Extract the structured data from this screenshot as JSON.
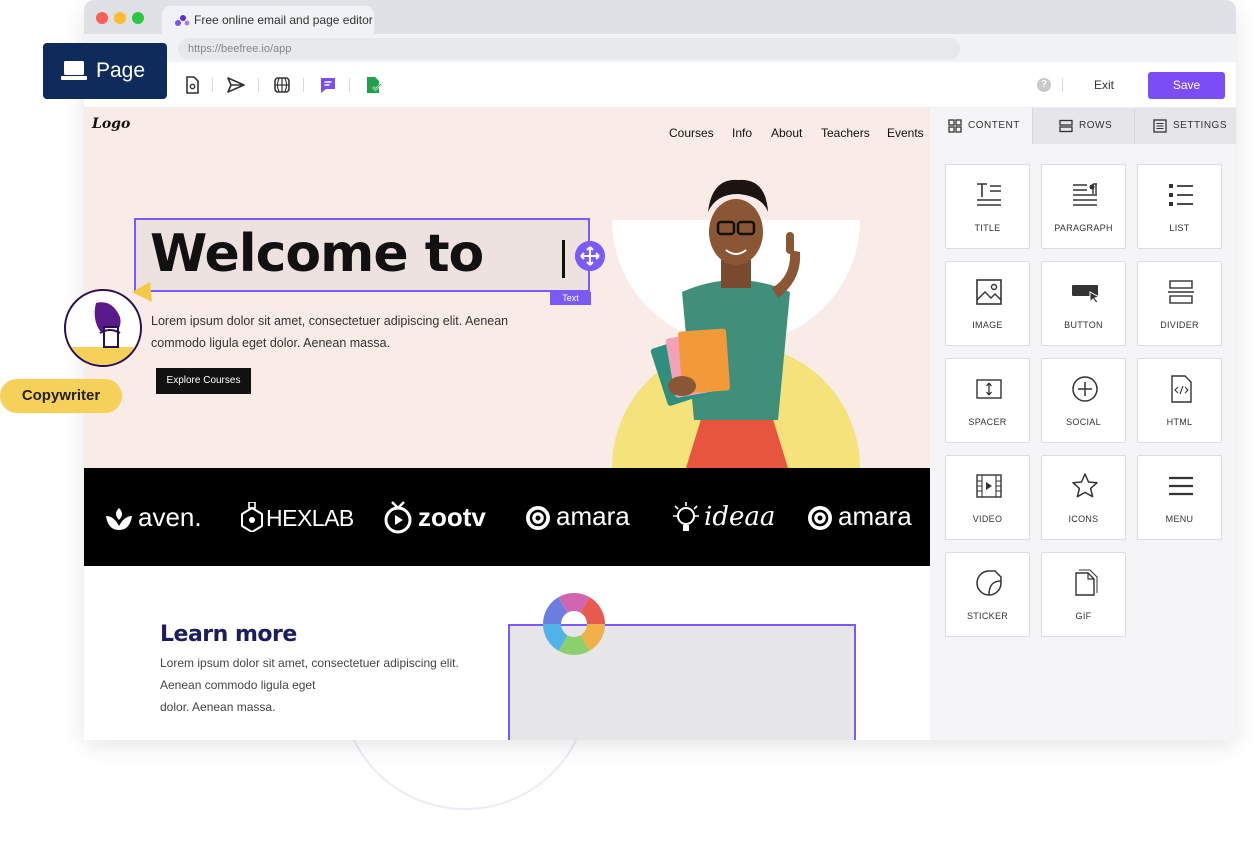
{
  "browser": {
    "tab_title": "Free online email and page editor",
    "url": "https://beefree.io/app"
  },
  "badges": {
    "page_label": "Page",
    "copywriter_label": "Copywriter"
  },
  "toolbar": {
    "help_label": "?",
    "exit_label": "Exit",
    "save_label": "Save"
  },
  "canvas": {
    "logo": "Logo",
    "nav": [
      "Courses",
      "Info",
      "About",
      "Teachers",
      "Events"
    ],
    "hero_heading": "Welcome to",
    "selection_tag": "Text",
    "hero_paragraph": "Lorem ipsum dolor sit amet, consectetuer adipiscing elit. Aenean commodo ligula eget dolor. Aenean massa.",
    "cta_label": "Explore Courses",
    "brands": [
      "aven.",
      "HEXLAB",
      "zootv",
      "amara",
      "ideaa",
      "amara"
    ],
    "learn_title": "Learn more",
    "learn_lines": [
      "Lorem ipsum dolor sit amet, consectetuer adipiscing elit.",
      "Aenean commodo ligula eget",
      "dolor. Aenean massa."
    ]
  },
  "sidebar": {
    "tabs": [
      "CONTENT",
      "ROWS",
      "SETTINGS"
    ],
    "active_tab": "CONTENT",
    "blocks": [
      "TITLE",
      "PARAGRAPH",
      "LIST",
      "IMAGE",
      "BUTTON",
      "DIVIDER",
      "SPACER",
      "SOCIAL",
      "HTML",
      "VIDEO",
      "ICONS",
      "MENU",
      "STICKER",
      "GIF"
    ]
  },
  "colors": {
    "accent": "#7b4df7",
    "hero_bg": "#f9ebe6",
    "brand_strip": "#000000",
    "page_badge": "#0e2b5b",
    "copywriter_badge": "#f6d159"
  }
}
